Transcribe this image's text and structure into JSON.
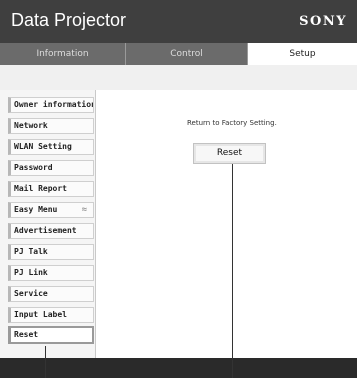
{
  "header": {
    "title": "Data Projector",
    "brand": "SONY"
  },
  "tabs": [
    {
      "label": "Information",
      "active": false
    },
    {
      "label": "Control",
      "active": false
    },
    {
      "label": "Setup",
      "active": true
    }
  ],
  "sidebar": {
    "items": [
      {
        "label": "Owner information"
      },
      {
        "label": "Network"
      },
      {
        "label": "WLAN Setting"
      },
      {
        "label": "Password"
      },
      {
        "label": "Mail Report"
      },
      {
        "label": "Easy Menu",
        "icon": "double-chevron-up-icon",
        "icon_glyph": "≈"
      },
      {
        "label": "Advertisement"
      },
      {
        "label": "PJ Talk"
      },
      {
        "label": "PJ Link"
      },
      {
        "label": "Service"
      },
      {
        "label": "Input Label"
      },
      {
        "label": "Reset",
        "selected": true
      }
    ]
  },
  "main": {
    "message": "Return to Factory Setting.",
    "reset_button_label": "Reset"
  },
  "colors": {
    "header_bg": "#3f3f3f",
    "tab_bg": "#6b6b6b",
    "active_tab_bg": "#ffffff",
    "footer_bg": "#2a2a2a"
  }
}
